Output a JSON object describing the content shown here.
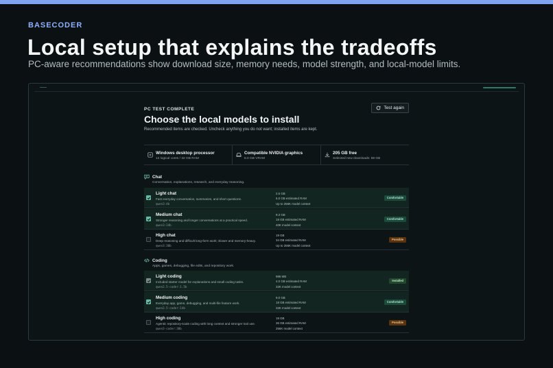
{
  "brand": "BASECODER",
  "hero": {
    "title": "Local setup that explains the tradeoffs",
    "subtitle": "PC-aware recommendations show download size, memory needs, model strength, and local-model limits."
  },
  "panel": {
    "eyebrow": "PC TEST COMPLETE",
    "title": "Choose the local models to install",
    "subtitle": "Recommended items are checked. Uncheck anything you do not want; installed items are kept.",
    "test_again_label": "Test again"
  },
  "specs": [
    {
      "icon": "cpu-icon",
      "title": "Windows desktop processor",
      "sub": "12 logical cores / 32 GB RAM"
    },
    {
      "icon": "gpu-icon",
      "title": "Compatible NVIDIA graphics",
      "sub": "8.0 GB VRAM"
    },
    {
      "icon": "download-icon",
      "title": "205 GB free",
      "sub": "Selected new downloads: 59 GB"
    }
  ],
  "sections": [
    {
      "icon": "chat-icon",
      "title": "Chat",
      "desc": "Conversation, explanations, research, and everyday reasoning.",
      "models": [
        {
          "name": "Light chat",
          "desc": "Fast everyday conversation, summaries, and short questions.",
          "id": "qwen3:4b",
          "size": "2.5 GB",
          "ram": "6.0 GB estimated RAM",
          "context": "Up to 256K model context",
          "badge": "Comfortable",
          "badge_kind": "comfortable",
          "checked": true,
          "muted": false
        },
        {
          "name": "Medium chat",
          "desc": "Stronger reasoning and longer conversations at a practical speed.",
          "id": "qwen3:14b",
          "size": "9.3 GB",
          "ram": "18 GB estimated RAM",
          "context": "40K model context",
          "badge": "Comfortable",
          "badge_kind": "comfortable",
          "checked": true,
          "muted": false
        },
        {
          "name": "High chat",
          "desc": "Deep reasoning and difficult long-form work; slower and memory-heavy.",
          "id": "qwen3:30b",
          "size": "19 GB",
          "ram": "34 GB estimated RAM",
          "context": "Up to 256K model context",
          "badge": "Possible",
          "badge_kind": "possible",
          "checked": false,
          "muted": false
        }
      ]
    },
    {
      "icon": "code-icon",
      "title": "Coding",
      "desc": "Apps, games, debugging, file edits, and repository work.",
      "models": [
        {
          "name": "Light coding",
          "desc": "Included starter model for explanations and small coding tasks.",
          "id": "qwen2.5-coder:1.5b",
          "size": "986 MB",
          "ram": "4.0 GB estimated RAM",
          "context": "32K model context",
          "badge": "Installed",
          "badge_kind": "installed",
          "checked": true,
          "muted": true
        },
        {
          "name": "Medium coding",
          "desc": "Everyday app, game, debugging, and multi-file feature work.",
          "id": "qwen2.5-coder:14b",
          "size": "9.0 GB",
          "ram": "18 GB estimated RAM",
          "context": "32K model context",
          "badge": "Comfortable",
          "badge_kind": "comfortable",
          "checked": true,
          "muted": false
        },
        {
          "name": "High coding",
          "desc": "Agentic repository-scale coding with long context and stronger tool use.",
          "id": "qwen3-coder:30b",
          "size": "19 GB",
          "ram": "36 GB estimated RAM",
          "context": "256K model context",
          "badge": "Possible",
          "badge_kind": "possible",
          "checked": false,
          "muted": false
        }
      ]
    }
  ],
  "colors": {
    "accent": "#67b8a4",
    "brand": "#8fb0ff",
    "selected_row": "#122520",
    "possible": "#5a3410"
  }
}
